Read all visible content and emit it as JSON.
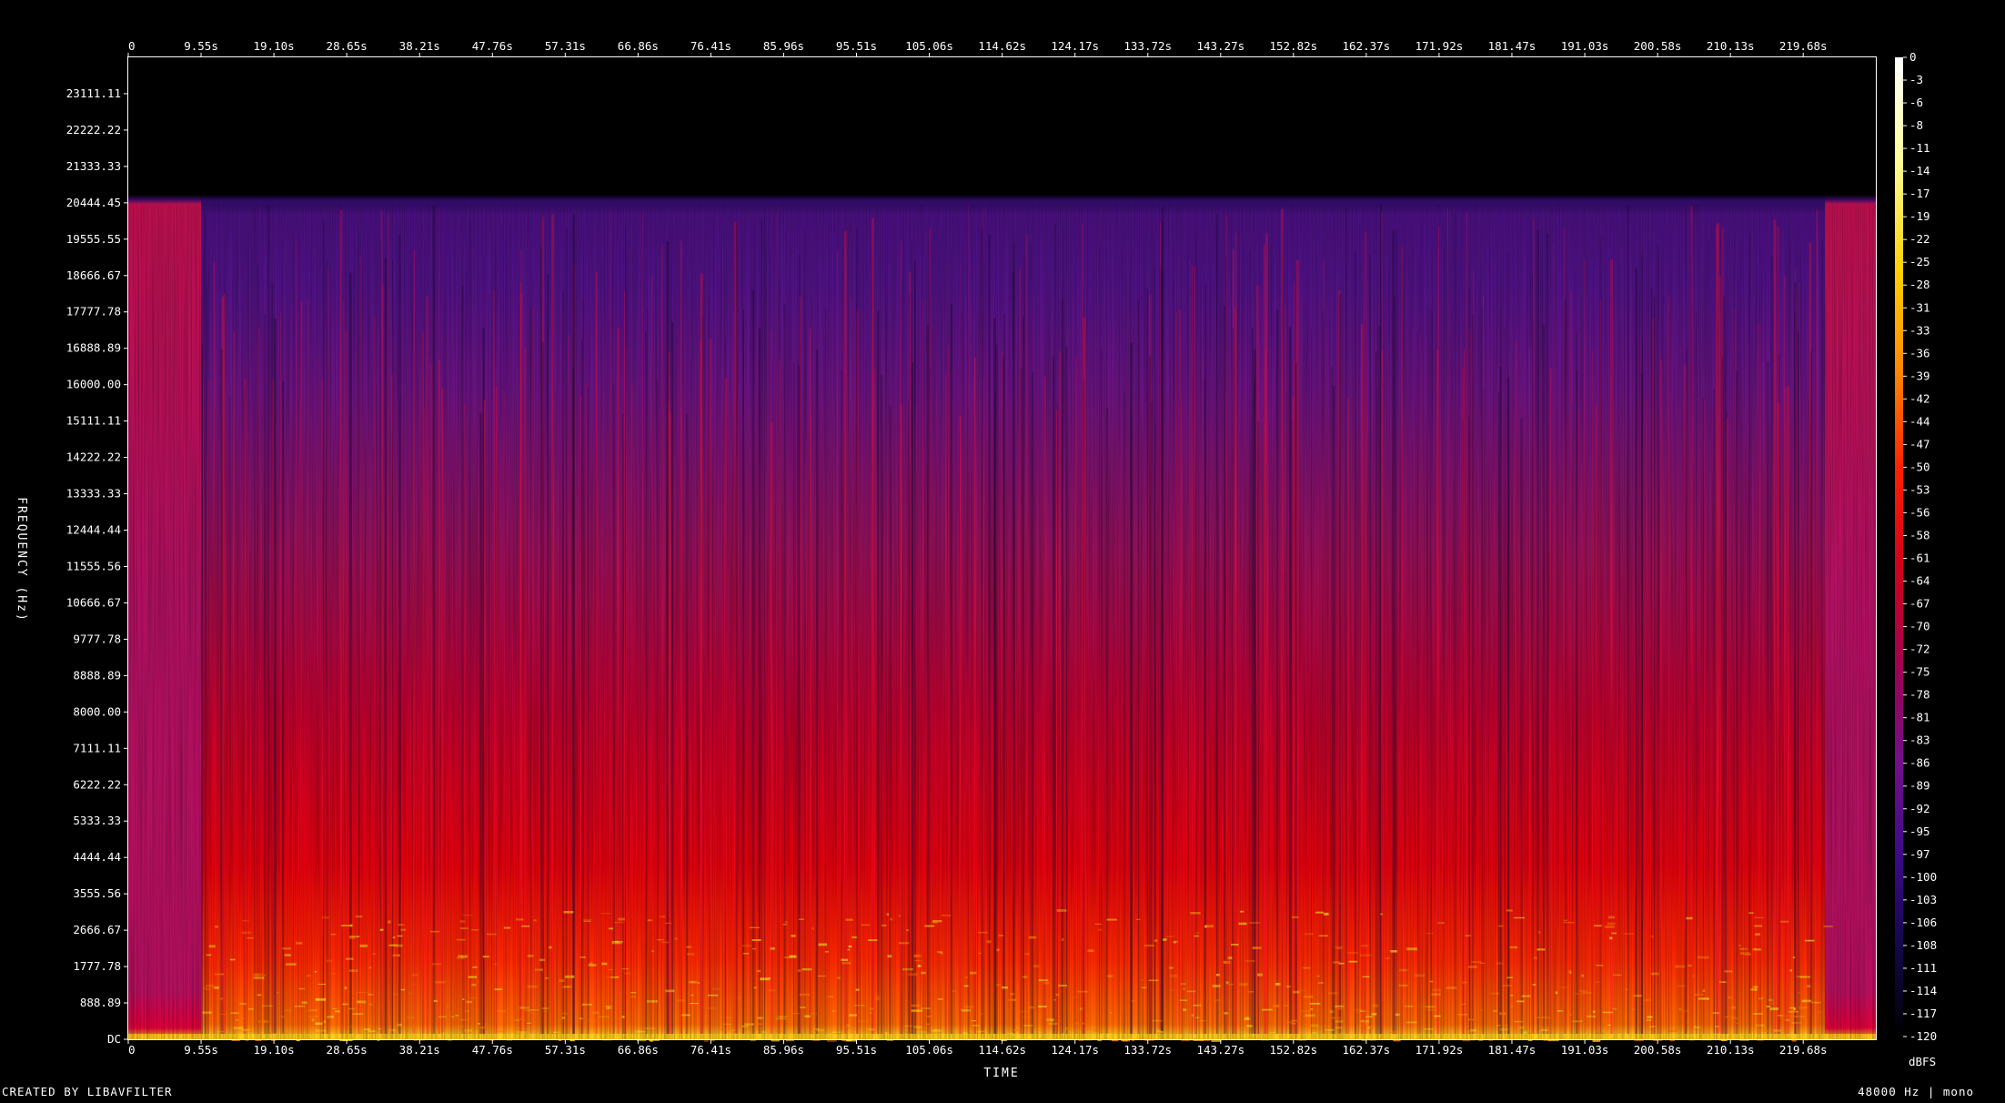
{
  "chart_data": {
    "type": "heatmap",
    "title": "",
    "xlabel": "TIME",
    "ylabel": "FREQUENCY (Hz)",
    "x_ticks": [
      "0",
      "9.55s",
      "19.10s",
      "28.65s",
      "38.21s",
      "47.76s",
      "57.31s",
      "66.86s",
      "76.41s",
      "85.96s",
      "95.51s",
      "105.06s",
      "114.62s",
      "124.17s",
      "133.72s",
      "143.27s",
      "152.82s",
      "162.37s",
      "171.92s",
      "181.47s",
      "191.03s",
      "200.58s",
      "210.13s",
      "219.68s"
    ],
    "x_tick_values": [
      0,
      9.55,
      19.1,
      28.65,
      38.21,
      47.76,
      57.31,
      66.86,
      76.41,
      85.96,
      95.51,
      105.06,
      114.62,
      124.17,
      133.72,
      143.27,
      152.82,
      162.37,
      171.92,
      181.47,
      191.03,
      200.58,
      210.13,
      219.68
    ],
    "xlim": [
      0,
      229.2
    ],
    "y_ticks": [
      "DC",
      "888.89",
      "1777.78",
      "2666.67",
      "3555.56",
      "4444.44",
      "5333.33",
      "6222.22",
      "7111.11",
      "8000.00",
      "8888.89",
      "9777.78",
      "10666.67",
      "11555.56",
      "12444.44",
      "13333.33",
      "14222.22",
      "15111.11",
      "16000.00",
      "16888.89",
      "17777.78",
      "18666.67",
      "19555.55",
      "20444.45",
      "21333.33",
      "22222.22",
      "23111.11"
    ],
    "y_tick_values": [
      0,
      888.89,
      1777.78,
      2666.67,
      3555.56,
      4444.44,
      5333.33,
      6222.22,
      7111.11,
      8000,
      8888.89,
      9777.78,
      10666.67,
      11555.56,
      12444.44,
      13333.33,
      14222.22,
      15111.11,
      16000,
      16888.89,
      17777.78,
      18666.67,
      19555.55,
      20444.45,
      21333.33,
      22222.22,
      23111.11
    ],
    "ylim": [
      0,
      24000
    ],
    "colorbar": {
      "label": "dBFS",
      "ticks": [
        "0",
        "-3",
        "-6",
        "-8",
        "-11",
        "-14",
        "-17",
        "-19",
        "-22",
        "-25",
        "-28",
        "-31",
        "-33",
        "-36",
        "-39",
        "-42",
        "-44",
        "-47",
        "-50",
        "-53",
        "-56",
        "-58",
        "-61",
        "-64",
        "-67",
        "-70",
        "-72",
        "-75",
        "-78",
        "-81",
        "-83",
        "-86",
        "-89",
        "-92",
        "-95",
        "-97",
        "-100",
        "-103",
        "-106",
        "-108",
        "-111",
        "-114",
        "-117",
        "-120"
      ],
      "range": [
        -120,
        0
      ],
      "colormap": [
        "#ffffff",
        "#ffffb0",
        "#ffd700",
        "#ff8c00",
        "#ff2000",
        "#d00010",
        "#a00050",
        "#70108a",
        "#3a0a80",
        "#140845",
        "#000000"
      ]
    },
    "signal": {
      "cutoff_hz": 20444.45,
      "shelf_hz": 16000,
      "intro_end_s": 9.55,
      "outro_start_s": 222.5
    }
  },
  "footer": {
    "left": "CREATED BY LIBAVFILTER",
    "right": "48000 Hz | mono"
  }
}
